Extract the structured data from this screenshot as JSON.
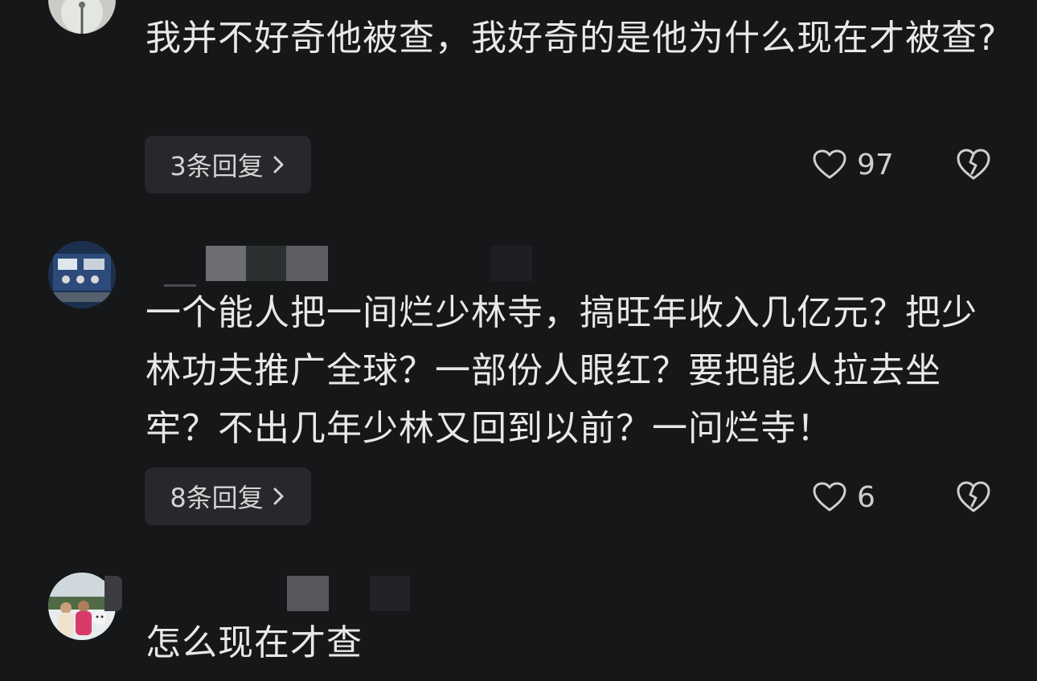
{
  "comments": [
    {
      "text": "我并不好奇他被查，我好奇的是他为什么现在才被查?",
      "reply_label": "3条回复",
      "like_count": "97",
      "avatar_icon": "dandelion-avatar"
    },
    {
      "text": "一个能人把一间烂少林寺，搞旺年收入几亿元？把少林功夫推广全球？一部份人眼红？要把能人拉去坐牢？不出几年少林又回到以前？一问烂寺！",
      "reply_label": "8条回复",
      "like_count": "6",
      "avatar_icon": "machine-avatar"
    },
    {
      "text": "怎么现在才查",
      "avatar_icon": "people-photo-avatar"
    }
  ],
  "icons": {
    "like": "heart-outline-icon",
    "dislike": "broken-heart-icon",
    "reply_arrow": "chevron-right-icon"
  },
  "colors": {
    "background": "#161719",
    "reply_button_bg": "#26282b",
    "text": "#e8e8e8"
  }
}
